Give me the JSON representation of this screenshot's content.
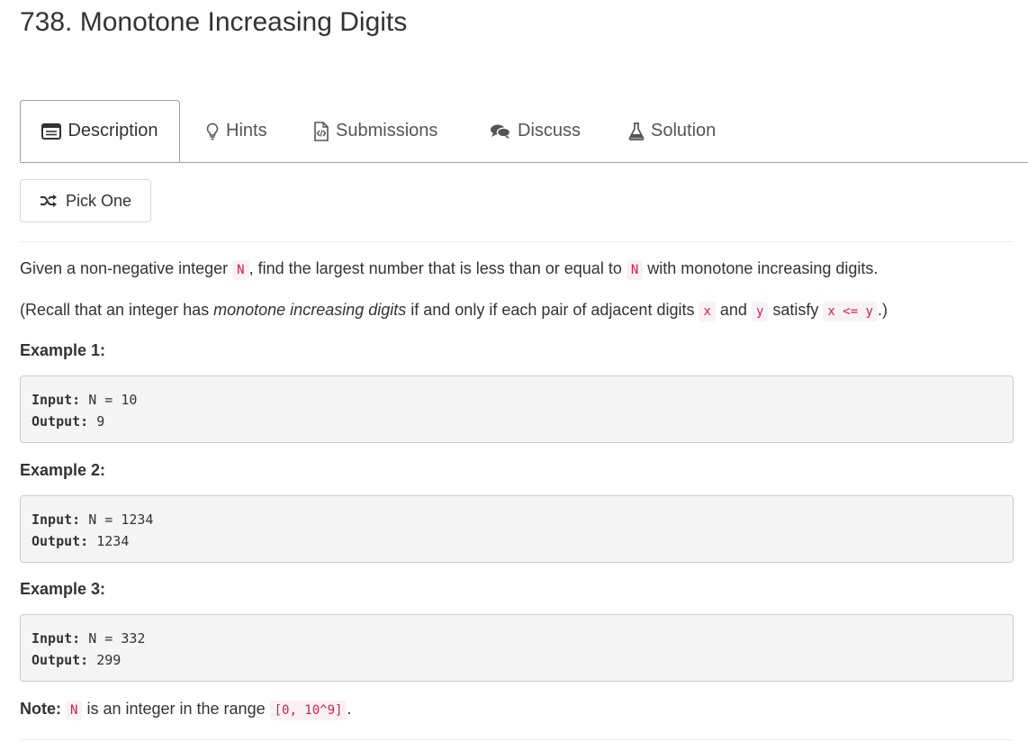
{
  "problem": {
    "title": "738. Monotone Increasing Digits"
  },
  "tabs": [
    {
      "label": "Description",
      "icon": "description-icon",
      "active": true
    },
    {
      "label": "Hints",
      "icon": "lightbulb-icon"
    },
    {
      "label": "Submissions",
      "icon": "code-file-icon"
    },
    {
      "label": "Discuss",
      "icon": "comments-icon"
    },
    {
      "label": "Solution",
      "icon": "flask-icon"
    }
  ],
  "pick_one": {
    "label": "Pick One",
    "icon": "shuffle-icon"
  },
  "description": {
    "p1_a": "Given a non-negative integer ",
    "p1_code_n": "N",
    "p1_b": ", find the largest number that is less than or equal to ",
    "p1_code_n2": "N",
    "p1_c": " with monotone increasing digits.",
    "p2_a": "(Recall that an integer has ",
    "p2_em": "monotone increasing digits",
    "p2_b": " if and only if each pair of adjacent digits ",
    "p2_code_x": "x",
    "p2_c": " and ",
    "p2_code_y": "y",
    "p2_d": " satisfy ",
    "p2_code_cond": "x <= y",
    "p2_e": ".)"
  },
  "examples": [
    {
      "heading": "Example 1:",
      "input_label": "Input:",
      "input_value": " N = 10",
      "output_label": "Output:",
      "output_value": " 9"
    },
    {
      "heading": "Example 2:",
      "input_label": "Input:",
      "input_value": " N = 1234",
      "output_label": "Output:",
      "output_value": " 1234"
    },
    {
      "heading": "Example 3:",
      "input_label": "Input:",
      "input_value": " N = 332",
      "output_label": "Output:",
      "output_value": " 299"
    }
  ],
  "note": {
    "label": "Note:",
    "code_n": "N",
    "text": " is an integer in the range ",
    "code_range": "[0, 10^9]",
    "end": "."
  },
  "colors": {
    "inline_code_text": "#c7254e",
    "inline_code_bg": "#f9f2f4",
    "pre_bg": "#f5f5f5",
    "tab_border": "#9e9e9e"
  }
}
